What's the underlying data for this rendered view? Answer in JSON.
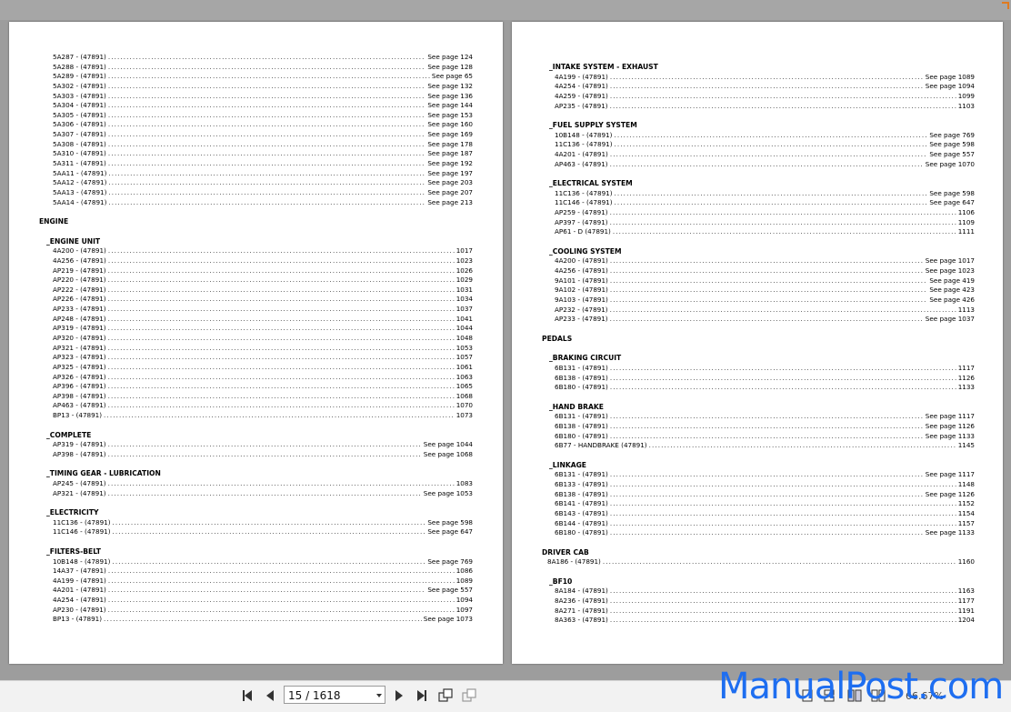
{
  "left_page": {
    "top_rows": [
      [
        "5A287 - (47891)",
        "See page 124"
      ],
      [
        "5A288 - (47891)",
        "See page 128"
      ],
      [
        "5A289 - (47891)",
        "See page 65"
      ],
      [
        "5A302 - (47891)",
        "See page 132"
      ],
      [
        "5A303 - (47891)",
        "See page 136"
      ],
      [
        "5A304 - (47891)",
        "See page 144"
      ],
      [
        "5A305 - (47891)",
        "See page 153"
      ],
      [
        "5A306 - (47891)",
        "See page 160"
      ],
      [
        "5A307 - (47891)",
        "See page 169"
      ],
      [
        "5A308 - (47891)",
        "See page 178"
      ],
      [
        "5A310 - (47891)",
        "See page 187"
      ],
      [
        "5A311 - (47891)",
        "See page 192"
      ],
      [
        "5AA11 - (47891)",
        "See page 197"
      ],
      [
        "5AA12 - (47891)",
        "See page 203"
      ],
      [
        "5AA13 - (47891)",
        "See page 207"
      ],
      [
        "5AA14 - (47891)",
        "See page 213"
      ]
    ],
    "heading": "ENGINE",
    "sections": [
      {
        "title": "_ENGINE UNIT",
        "rows": [
          [
            "4A200 - (47891)",
            "1017"
          ],
          [
            "4A256 - (47891)",
            "1023"
          ],
          [
            "AP219 - (47891)",
            "1026"
          ],
          [
            "AP220 - (47891)",
            "1029"
          ],
          [
            "AP222 - (47891)",
            "1031"
          ],
          [
            "AP226 - (47891)",
            "1034"
          ],
          [
            "AP233 - (47891)",
            "1037"
          ],
          [
            "AP248 - (47891)",
            "1041"
          ],
          [
            "AP319 - (47891)",
            "1044"
          ],
          [
            "AP320 - (47891)",
            "1048"
          ],
          [
            "AP321 - (47891)",
            "1053"
          ],
          [
            "AP323 - (47891)",
            "1057"
          ],
          [
            "AP325 - (47891)",
            "1061"
          ],
          [
            "AP326 - (47891)",
            "1063"
          ],
          [
            "AP396 - (47891)",
            "1065"
          ],
          [
            "AP398 - (47891)",
            "1068"
          ],
          [
            "AP463 - (47891)",
            "1070"
          ],
          [
            "BP13 - (47891)",
            "1073"
          ]
        ]
      },
      {
        "title": "_COMPLETE",
        "rows": [
          [
            "AP319 - (47891)",
            "See page 1044"
          ],
          [
            "AP398 - (47891)",
            "See page 1068"
          ]
        ]
      },
      {
        "title": "_TIMING GEAR - LUBRICATION",
        "rows": [
          [
            "AP245 - (47891)",
            "1083"
          ],
          [
            "AP321 - (47891)",
            "See page 1053"
          ]
        ]
      },
      {
        "title": "_ELECTRICITY",
        "rows": [
          [
            "11C136 - (47891)",
            "See page 598"
          ],
          [
            "11C146 - (47891)",
            "See page 647"
          ]
        ]
      },
      {
        "title": "_FILTERS-BELT",
        "rows": [
          [
            "10B148 - (47891)",
            "See page 769"
          ],
          [
            "14A37 - (47891)",
            "1086"
          ],
          [
            "4A199 - (47891)",
            "1089"
          ],
          [
            "4A201 - (47891)",
            "See page 557"
          ],
          [
            "4A254 - (47891)",
            "1094"
          ],
          [
            "AP230 - (47891)",
            "1097"
          ],
          [
            "BP13 - (47891)",
            "See page 1073"
          ]
        ]
      }
    ]
  },
  "right_page": {
    "blocks": [
      {
        "kind": "sub",
        "title": "_INTAKE SYSTEM - EXHAUST",
        "rows": [
          [
            "4A199 - (47891)",
            "See page 1089"
          ],
          [
            "4A254 - (47891)",
            "See page 1094"
          ],
          [
            "4A259 - (47891)",
            "1099"
          ],
          [
            "AP235 - (47891)",
            "1103"
          ]
        ]
      },
      {
        "kind": "sub",
        "title": "_FUEL SUPPLY SYSTEM",
        "rows": [
          [
            "10B148 - (47891)",
            "See page 769"
          ],
          [
            "11C136 - (47891)",
            "See page 598"
          ],
          [
            "4A201 - (47891)",
            "See page 557"
          ],
          [
            "AP463 - (47891)",
            "See page 1070"
          ]
        ]
      },
      {
        "kind": "sub",
        "title": "_ELECTRICAL SYSTEM",
        "rows": [
          [
            "11C136 - (47891)",
            "See page 598"
          ],
          [
            "11C146 - (47891)",
            "See page 647"
          ],
          [
            "AP259 - (47891)",
            "1106"
          ],
          [
            "AP397 - (47891)",
            "1109"
          ],
          [
            "AP61 - D (47891)",
            "1111"
          ]
        ]
      },
      {
        "kind": "sub",
        "title": "_COOLING SYSTEM",
        "rows": [
          [
            "4A200 - (47891)",
            "See page 1017"
          ],
          [
            "4A256 - (47891)",
            "See page 1023"
          ],
          [
            "9A101 - (47891)",
            "See page 419"
          ],
          [
            "9A102 - (47891)",
            "See page 423"
          ],
          [
            "9A103 - (47891)",
            "See page 426"
          ],
          [
            "AP232 - (47891)",
            "1113"
          ],
          [
            "AP233 - (47891)",
            "See page 1037"
          ]
        ]
      },
      {
        "kind": "head",
        "title": "PEDALS",
        "rows": []
      },
      {
        "kind": "sub",
        "title": "_BRAKING CIRCUIT",
        "rows": [
          [
            "6B131 - (47891)",
            "1117"
          ],
          [
            "6B138 - (47891)",
            "1126"
          ],
          [
            "6B180 - (47891)",
            "1133"
          ]
        ]
      },
      {
        "kind": "sub",
        "title": "_HAND BRAKE",
        "rows": [
          [
            "6B131 - (47891)",
            "See page 1117"
          ],
          [
            "6B138 - (47891)",
            "See page 1126"
          ],
          [
            "6B180 - (47891)",
            "See page 1133"
          ],
          [
            "6B77 - HANDBRAKE (47891)",
            "1145"
          ]
        ]
      },
      {
        "kind": "sub",
        "title": "_LINKAGE",
        "rows": [
          [
            "6B131 - (47891)",
            "See page 1117"
          ],
          [
            "6B133 - (47891)",
            "1148"
          ],
          [
            "6B138 - (47891)",
            "See page 1126"
          ],
          [
            "6B141 - (47891)",
            "1152"
          ],
          [
            "6B143 - (47891)",
            "1154"
          ],
          [
            "6B144 - (47891)",
            "1157"
          ],
          [
            "6B180 - (47891)",
            "See page 1133"
          ]
        ]
      },
      {
        "kind": "head",
        "title": "DRIVER CAB",
        "rows": [
          [
            "8A186 - (47891)",
            "1160"
          ]
        ]
      },
      {
        "kind": "sub",
        "title": "_BF10",
        "rows": [
          [
            "8A184 - (47891)",
            "1163"
          ],
          [
            "8A236 - (47891)",
            "1177"
          ],
          [
            "8A271 - (47891)",
            "1191"
          ],
          [
            "8A363 - (47891)",
            "1204"
          ]
        ]
      }
    ]
  },
  "toolbar": {
    "page_indicator": "15 / 1618",
    "zoom": "66.67%",
    "icons": [
      "first-page-icon",
      "previous-page-icon",
      "next-page-icon",
      "last-page-icon",
      "rotate-icon",
      "copy-icon"
    ]
  },
  "watermark": "ManualPost.com"
}
